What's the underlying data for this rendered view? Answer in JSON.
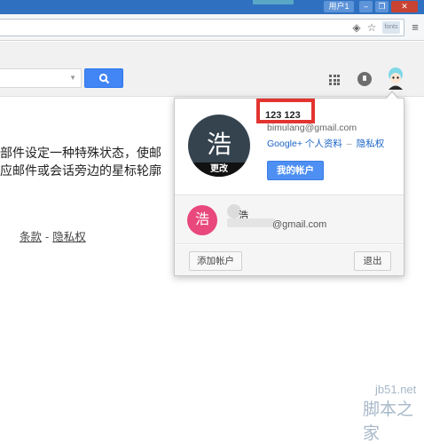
{
  "titlebar": {
    "user_label": "用户1",
    "minimize": "–",
    "restore": "❐",
    "close": "✕"
  },
  "addressbar": {
    "extension_label": "fonts",
    "menu_glyph": "≡"
  },
  "googlebar": {
    "search_value": ""
  },
  "content": {
    "line1": "部件设定一种特殊状态，使邮",
    "line2": "应邮件或会话旁边的星标轮廓",
    "footer_terms": "条款",
    "footer_sep": " - ",
    "footer_privacy": "隐私权"
  },
  "popup": {
    "avatar_char": "浩",
    "avatar_change": "更改",
    "name": "123 123",
    "email": "bimulang@gmail.com",
    "link_profile": "Google+ 个人资料",
    "link_sep": "–",
    "link_privacy": "隐私权",
    "my_account_button": "我的帐户",
    "other_account": {
      "avatar_char": "浩",
      "name": "浩",
      "email": "@gmail.com"
    },
    "add_account_button": "添加帐户",
    "signout_button": "退出"
  },
  "watermark": {
    "line1": "jb51.net",
    "line2": "脚本之家"
  },
  "colors": {
    "accent_blue": "#4285f4",
    "title_blue": "#2f71c0",
    "highlight_red": "#e3342f",
    "avatar_dark": "#35434f",
    "avatar_pink": "#e8487c"
  }
}
